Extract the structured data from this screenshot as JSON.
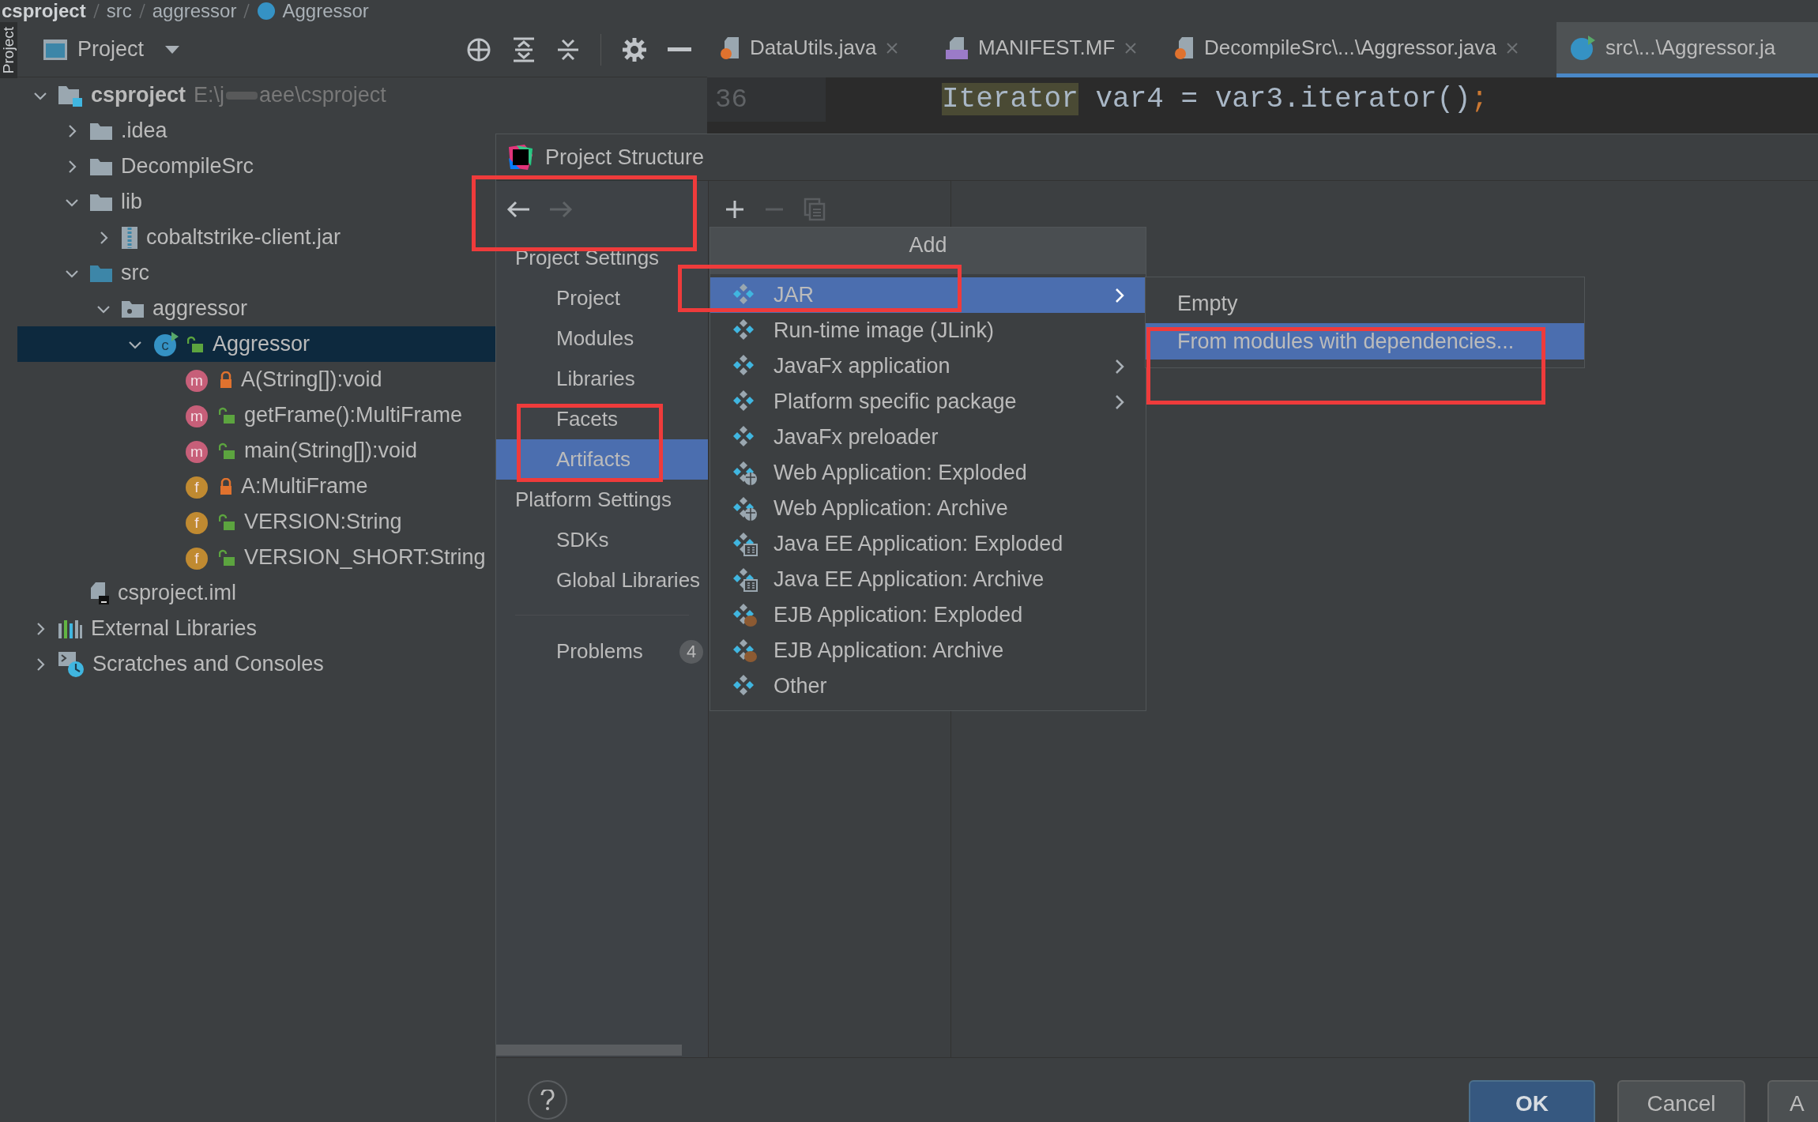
{
  "breadcrumbs": [
    {
      "label": "csproject",
      "kind": "project"
    },
    {
      "label": "src",
      "kind": "folder"
    },
    {
      "label": "aggressor",
      "kind": "folder"
    },
    {
      "label": "Aggressor",
      "kind": "class"
    }
  ],
  "side_strip": {
    "label": "Project"
  },
  "project_panel": {
    "title": "Project"
  },
  "tree": [
    {
      "label": "csproject",
      "kind": "project",
      "path_parts": [
        "E:\\j",
        "aee\\csproject"
      ],
      "expanded": true,
      "selected": false,
      "children": [
        {
          "label": ".idea",
          "kind": "folder",
          "expanded": false,
          "selected": false
        },
        {
          "label": "DecompileSrc",
          "kind": "folder",
          "expanded": false,
          "selected": false
        },
        {
          "label": "lib",
          "kind": "folder",
          "expanded": true,
          "selected": false,
          "children": [
            {
              "label": "cobaltstrike-client.jar",
              "kind": "jar",
              "expanded": false,
              "selected": false
            }
          ]
        },
        {
          "label": "src",
          "kind": "source-folder",
          "expanded": true,
          "selected": false,
          "children": [
            {
              "label": "aggressor",
              "kind": "package",
              "expanded": true,
              "selected": false,
              "children": [
                {
                  "label": "Aggressor",
                  "kind": "class",
                  "icon_letter": "c",
                  "private": false,
                  "expanded": true,
                  "selected": true,
                  "children": [
                    {
                      "label": "A(String[]):void",
                      "kind": "method",
                      "icon_letter": "m",
                      "private": true,
                      "selected": false
                    },
                    {
                      "label": "getFrame():MultiFrame",
                      "kind": "method",
                      "icon_letter": "m",
                      "private": false,
                      "selected": false
                    },
                    {
                      "label": "main(String[]):void",
                      "kind": "method",
                      "icon_letter": "m",
                      "private": false,
                      "selected": false
                    },
                    {
                      "label": "A:MultiFrame",
                      "kind": "field",
                      "icon_letter": "f",
                      "private": true,
                      "selected": false
                    },
                    {
                      "label": "VERSION:String",
                      "kind": "field",
                      "icon_letter": "f",
                      "private": false,
                      "selected": false
                    },
                    {
                      "label": "VERSION_SHORT:String",
                      "kind": "field",
                      "icon_letter": "f",
                      "private": false,
                      "selected": false
                    }
                  ]
                }
              ]
            }
          ]
        },
        {
          "label": "csproject.iml",
          "kind": "file",
          "selected": false
        }
      ]
    },
    {
      "label": "External Libraries",
      "kind": "libraries",
      "expanded": false,
      "selected": false
    },
    {
      "label": "Scratches and Consoles",
      "kind": "scratches",
      "expanded": false,
      "selected": false
    }
  ],
  "editor": {
    "tabs": [
      {
        "label": "DataUtils.java",
        "kind": "java",
        "selected": false
      },
      {
        "label": "MANIFEST.MF",
        "kind": "manifest",
        "selected": false
      },
      {
        "label": "DecompileSrc\\...\\Aggressor.java",
        "kind": "java",
        "selected": false
      },
      {
        "label": "src\\...\\Aggressor.ja",
        "kind": "class",
        "selected": true
      }
    ],
    "line_number": "36",
    "code": [
      {
        "text": "Iterator",
        "kind": "highlighted"
      },
      {
        "text": " var4 = var3.iterator()",
        "kind": "plain"
      },
      {
        "text": ";",
        "kind": "punctuation"
      }
    ]
  },
  "dialog": {
    "title": "Project Structure",
    "nav_buttons": [
      {
        "kind": "back",
        "disabled": false
      },
      {
        "kind": "forward",
        "disabled": true
      }
    ],
    "nav": [
      {
        "kind": "header",
        "label": "Project Settings"
      },
      {
        "kind": "item",
        "label": "Project",
        "selected": false
      },
      {
        "kind": "item",
        "label": "Modules",
        "selected": false
      },
      {
        "kind": "item",
        "label": "Libraries",
        "selected": false
      },
      {
        "kind": "item",
        "label": "Facets",
        "selected": false
      },
      {
        "kind": "item",
        "label": "Artifacts",
        "selected": true
      },
      {
        "kind": "header",
        "label": "Platform Settings"
      },
      {
        "kind": "item",
        "label": "SDKs",
        "selected": false
      },
      {
        "kind": "item",
        "label": "Global Libraries",
        "selected": false
      },
      {
        "kind": "problems",
        "label": "Problems",
        "badge": "4",
        "selected": false
      }
    ],
    "toolbar": [
      {
        "kind": "add",
        "disabled": false
      },
      {
        "kind": "remove",
        "disabled": true
      },
      {
        "kind": "copy",
        "disabled": true
      }
    ],
    "popup": {
      "title": "Add",
      "items": [
        {
          "label": "JAR",
          "kind": "artifact",
          "submenu": true,
          "selected": true
        },
        {
          "label": "Run-time image (JLink)",
          "kind": "artifact",
          "submenu": false,
          "selected": false
        },
        {
          "label": "JavaFx application",
          "kind": "artifact",
          "submenu": true,
          "selected": false
        },
        {
          "label": "Platform specific package",
          "kind": "artifact",
          "submenu": true,
          "selected": false
        },
        {
          "label": "JavaFx preloader",
          "kind": "artifact",
          "submenu": false,
          "selected": false
        },
        {
          "label": "Web Application: Exploded",
          "kind": "web",
          "submenu": false,
          "selected": false
        },
        {
          "label": "Web Application: Archive",
          "kind": "web",
          "submenu": false,
          "selected": false
        },
        {
          "label": "Java EE Application: Exploded",
          "kind": "javaee",
          "submenu": false,
          "selected": false
        },
        {
          "label": "Java EE Application: Archive",
          "kind": "javaee",
          "submenu": false,
          "selected": false
        },
        {
          "label": "EJB Application: Exploded",
          "kind": "ejb",
          "submenu": false,
          "selected": false
        },
        {
          "label": "EJB Application: Archive",
          "kind": "ejb",
          "submenu": false,
          "selected": false
        },
        {
          "label": "Other",
          "kind": "artifact",
          "submenu": false,
          "selected": false
        }
      ]
    },
    "submenu": {
      "items": [
        {
          "label": "Empty",
          "selected": false
        },
        {
          "label": "From modules with dependencies...",
          "selected": true
        }
      ]
    },
    "buttons": [
      {
        "label": "OK",
        "kind": "default"
      },
      {
        "label": "Cancel",
        "kind": "normal"
      },
      {
        "label": "A",
        "kind": "normal"
      }
    ]
  },
  "annotations": [
    {
      "kind": "box"
    },
    {
      "kind": "box"
    },
    {
      "kind": "box"
    },
    {
      "kind": "box"
    }
  ]
}
